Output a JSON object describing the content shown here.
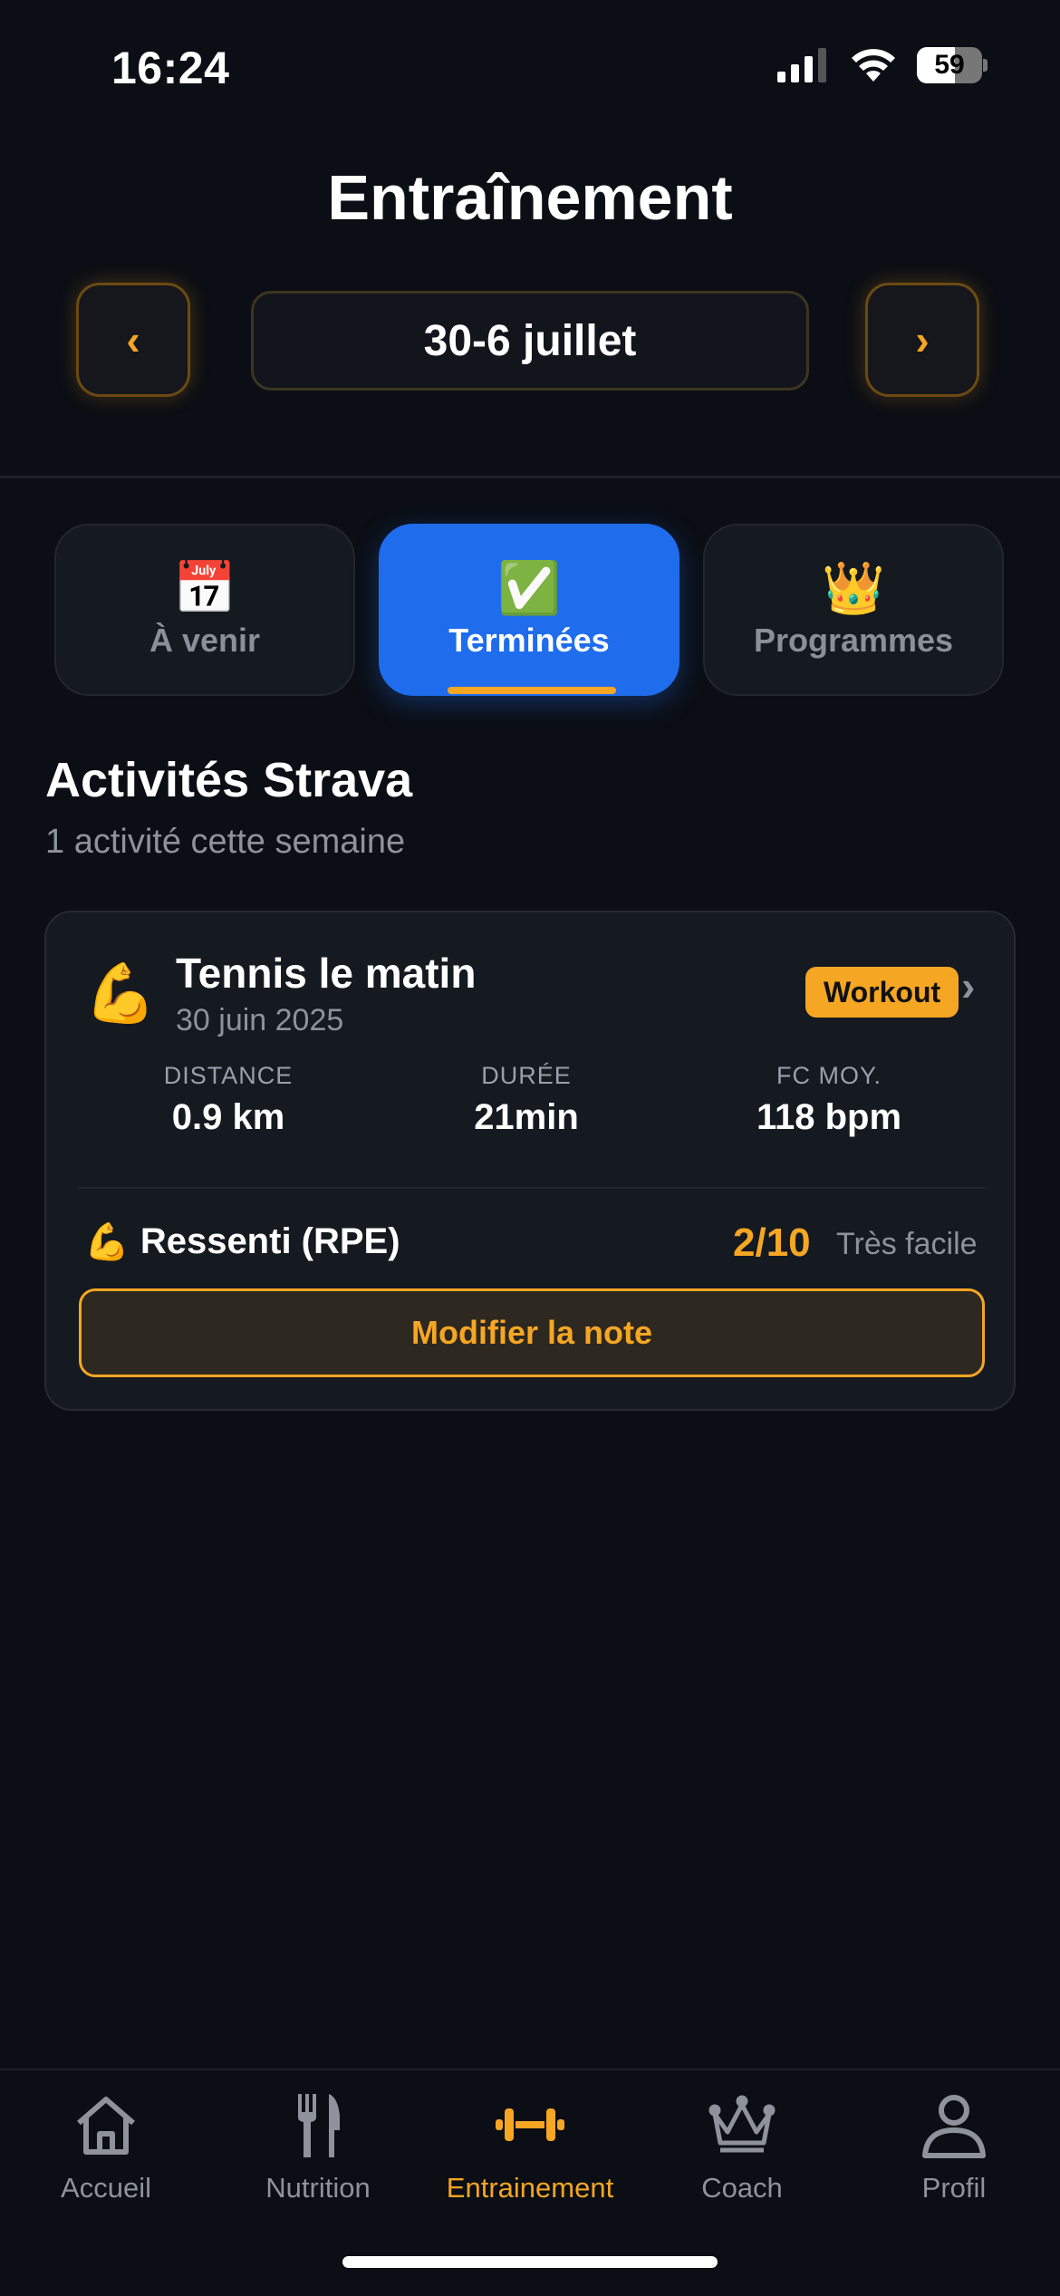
{
  "status_bar": {
    "time": "16:24",
    "battery": "59",
    "battery_level": 0.59
  },
  "header": {
    "title": "Entraînement",
    "prev_label": "‹",
    "next_label": "›",
    "week": "30-6 juillet"
  },
  "tabs": [
    {
      "emoji": "📅",
      "label": "À venir",
      "active": false
    },
    {
      "emoji": "✅",
      "label": "Terminées",
      "active": true
    },
    {
      "emoji": "👑",
      "label": "Programmes",
      "active": false
    }
  ],
  "section": {
    "title": "Activités Strava",
    "subtitle": "1 activité cette semaine"
  },
  "activity": {
    "emoji": "💪",
    "title": "Tennis le matin",
    "date": "30 juin 2025",
    "badge": "Workout",
    "chevron": "›",
    "stats": [
      {
        "label": "DISTANCE",
        "value": "0.9 km"
      },
      {
        "label": "DURÉE",
        "value": "21min"
      },
      {
        "label": "FC MOY.",
        "value": "118 bpm"
      }
    ],
    "rpe": {
      "emoji": "💪",
      "label": "Ressenti (RPE)",
      "value": "2/10",
      "description": "Très facile"
    },
    "edit_button": "Modifier la note"
  },
  "bottom_nav": [
    {
      "label": "Accueil",
      "icon": "home-icon",
      "active": false
    },
    {
      "label": "Nutrition",
      "icon": "fork-knife-icon",
      "active": false
    },
    {
      "label": "Entrainement",
      "icon": "dumbbell-icon",
      "active": true
    },
    {
      "label": "Coach",
      "icon": "crown-icon",
      "active": false
    },
    {
      "label": "Profil",
      "icon": "person-icon",
      "active": false
    }
  ],
  "colors": {
    "accent": "#f5a623",
    "primary": "#1f6ded",
    "background": "#0b0e14",
    "card": "#151920"
  }
}
